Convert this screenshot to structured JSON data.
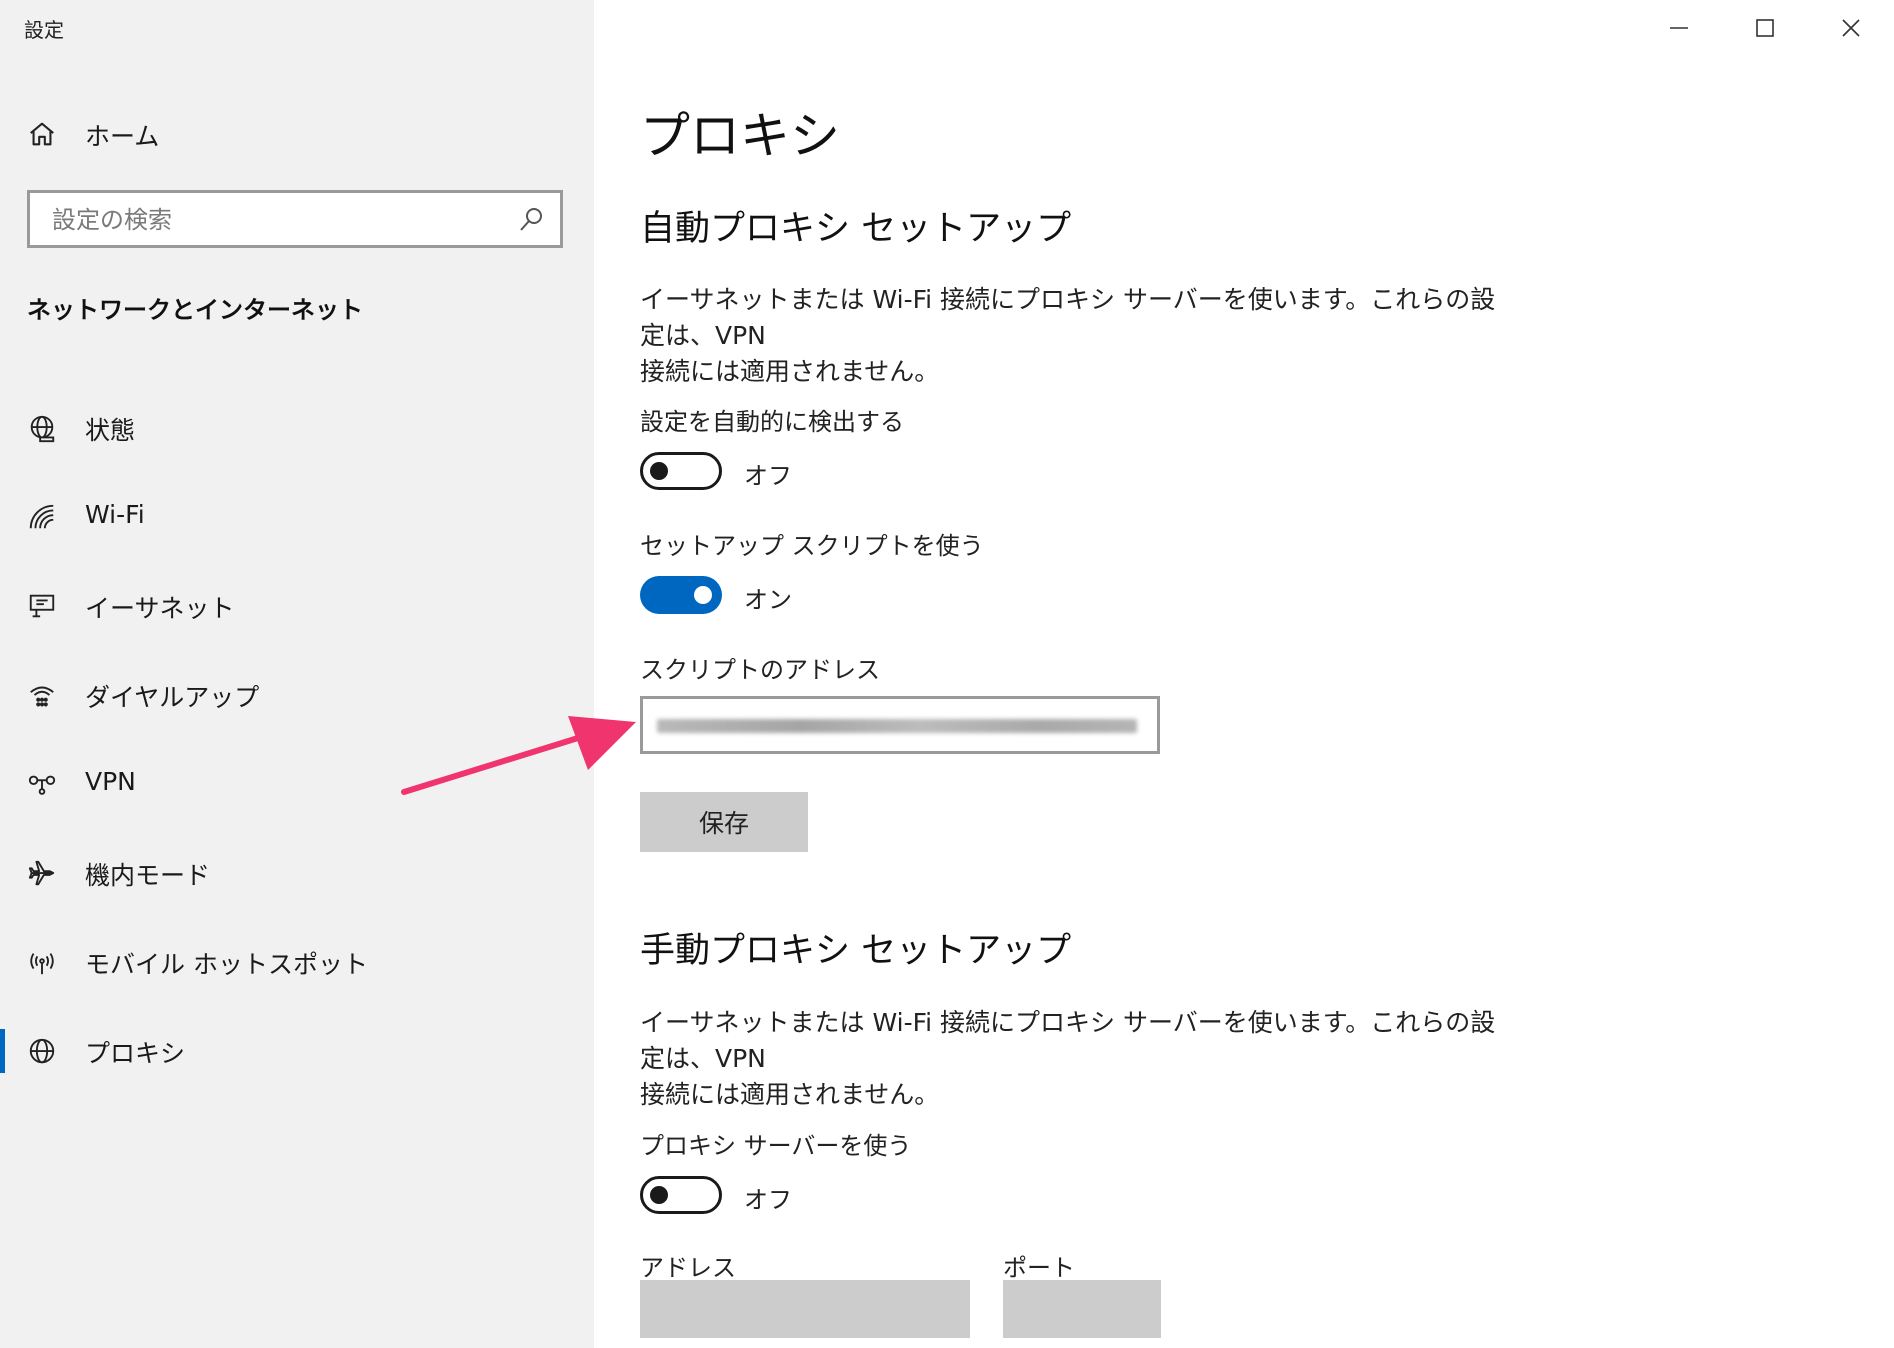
{
  "window": {
    "title": "設定",
    "controls": [
      "minimize-icon",
      "maximize-icon",
      "close-icon"
    ]
  },
  "sidebar": {
    "home_label": "ホーム",
    "search_placeholder": "設定の検索",
    "section_heading": "ネットワークとインターネット",
    "items": [
      {
        "label": "状態",
        "icon": "status-globe-icon",
        "active": false
      },
      {
        "label": "Wi-Fi",
        "icon": "wifi-icon",
        "active": false
      },
      {
        "label": "イーサネット",
        "icon": "ethernet-icon",
        "active": false
      },
      {
        "label": "ダイヤルアップ",
        "icon": "dialup-icon",
        "active": false
      },
      {
        "label": "VPN",
        "icon": "vpn-icon",
        "active": false
      },
      {
        "label": "機内モード",
        "icon": "airplane-icon",
        "active": false
      },
      {
        "label": "モバイル ホットスポット",
        "icon": "hotspot-icon",
        "active": false
      },
      {
        "label": "プロキシ",
        "icon": "globe-icon",
        "active": true
      }
    ]
  },
  "main": {
    "page_title": "プロキシ",
    "auto_setup": {
      "heading": "自動プロキシ セットアップ",
      "description_line1": "イーサネットまたは Wi-Fi 接続にプロキシ サーバーを使います。これらの設定は、VPN",
      "description_line2": "接続には適用されません。",
      "detect_label": "設定を自動的に検出する",
      "detect_state": "オフ",
      "detect_on": false,
      "script_label": "セットアップ スクリプトを使う",
      "script_state": "オン",
      "script_on": true,
      "address_label": "スクリプトのアドレス",
      "save_label": "保存"
    },
    "manual_setup": {
      "heading": "手動プロキシ セットアップ",
      "description_line1": "イーサネットまたは Wi-Fi 接続にプロキシ サーバーを使います。これらの設定は、VPN",
      "description_line2": "接続には適用されません。",
      "use_proxy_label": "プロキシ サーバーを使う",
      "use_proxy_state": "オフ",
      "use_proxy_on": false,
      "address_label": "アドレス",
      "port_label": "ポート"
    }
  },
  "colors": {
    "accent": "#0067c0",
    "annotation_arrow": "#f0346e",
    "sidebar_bg": "#f1f1f1",
    "button_bg": "#cccccc"
  }
}
